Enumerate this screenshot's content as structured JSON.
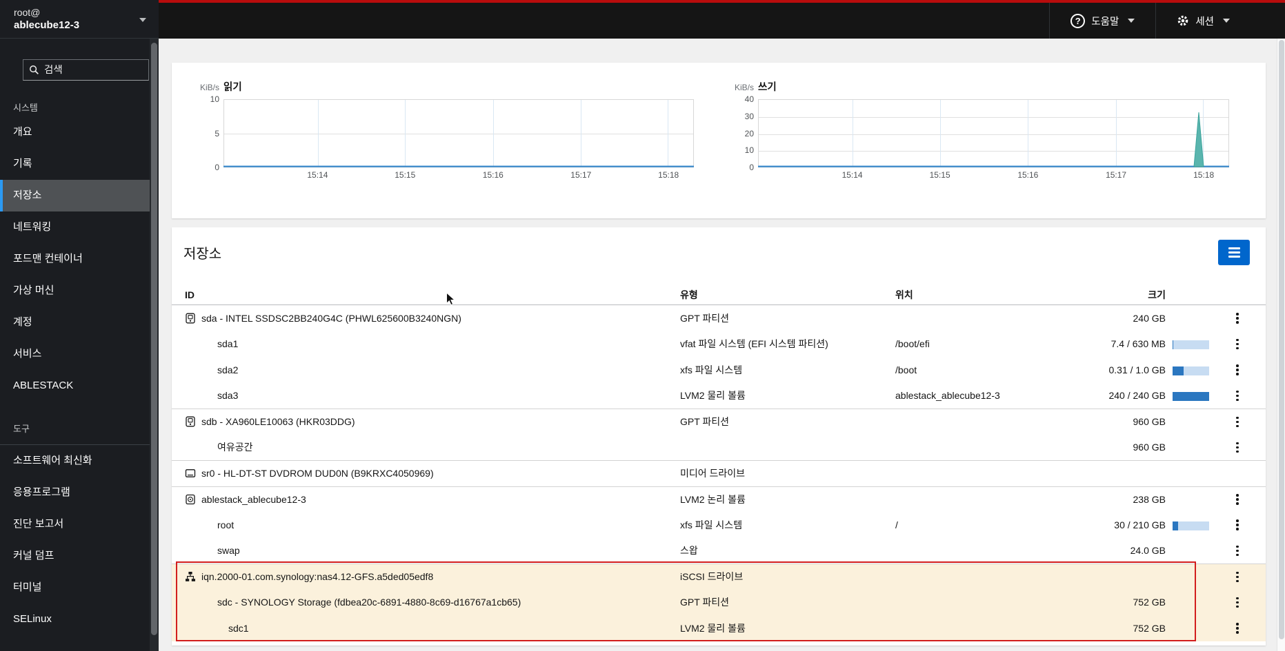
{
  "masthead": {
    "host_user": "root@",
    "host_name": "ablecube12-3",
    "help_label": "도움말",
    "session_label": "세션"
  },
  "sidebar": {
    "search_placeholder": "검색",
    "sections": [
      {
        "title": "시스템",
        "selected": "저장소",
        "items": [
          "개요",
          "기록",
          "저장소",
          "네트워킹",
          "포드맨 컨테이너",
          "가상 머신",
          "계정",
          "서비스",
          "ABLESTACK"
        ]
      },
      {
        "title": "도구",
        "items": [
          "소프트웨어 최신화",
          "응용프로그램",
          "진단 보고서",
          "커널 덤프",
          "터미널",
          "SELinux"
        ]
      }
    ]
  },
  "chart_data": [
    {
      "type": "area",
      "title": "읽기",
      "unit": "KiB/s",
      "x": [
        "15:14",
        "15:15",
        "15:16",
        "15:17",
        "15:18"
      ],
      "series": [
        {
          "name": "읽기",
          "values": [
            0,
            0,
            0,
            0,
            0
          ]
        }
      ],
      "ylim": [
        0,
        10
      ],
      "yticks": [
        10,
        5,
        0
      ],
      "grid": true,
      "line_color": "#3e8ed0"
    },
    {
      "type": "area",
      "title": "쓰기",
      "unit": "KiB/s",
      "x": [
        "15:14",
        "15:15",
        "15:16",
        "15:17",
        "15:18"
      ],
      "series": [
        {
          "name": "쓰기",
          "values": [
            0,
            0,
            0,
            0,
            32
          ]
        }
      ],
      "ylim": [
        0,
        40
      ],
      "yticks": [
        40,
        30,
        20,
        10,
        0
      ],
      "grid": true,
      "line_color": "#3e8ed0",
      "spike_color": "#5ab5ae",
      "spike_note": "spike ≈32 KiB/s at 15:18"
    }
  ],
  "storage": {
    "title": "저장소",
    "columns": {
      "id": "ID",
      "type": "유형",
      "location": "위치",
      "size": "크기"
    },
    "rows": [
      {
        "id": "sda - INTEL SSDSC2BB240G4C (PHWL625600B3240NGN)",
        "type": "GPT 파티션",
        "size": "240 GB"
      },
      {
        "id": "sda1",
        "type": "vfat 파일 시스템 (EFI 시스템 파티션)",
        "location": "/boot/efi",
        "size": "7.4 / 630 MB",
        "usage_pct": "1.2%"
      },
      {
        "id": "sda2",
        "type": "xfs 파일 시스템",
        "location": "/boot",
        "size": "0.31 / 1.0 GB",
        "usage_pct": "31%"
      },
      {
        "id": "sda3",
        "type": "LVM2 물리 볼륨",
        "location": "ablestack_ablecube12-3",
        "size": "240 / 240 GB",
        "usage_pct": "100%"
      },
      {
        "id": "sdb - XA960LE10063 (HKR03DDG)",
        "type": "GPT 파티션",
        "size": "960 GB"
      },
      {
        "id": "여유공간",
        "size": "960 GB"
      },
      {
        "id": "sr0 - HL-DT-ST DVDROM DUD0N (B9KRXC4050969)",
        "type": "미디어 드라이브"
      },
      {
        "id": "ablestack_ablecube12-3",
        "type": "LVM2 논리 볼륨",
        "size": "238 GB"
      },
      {
        "id": "root",
        "type": "xfs 파일 시스템",
        "location": "/",
        "size": "30 / 210 GB",
        "usage_pct": "14.3%"
      },
      {
        "id": "swap",
        "type": "스왑",
        "size": "24.0 GB"
      },
      {
        "id": "iqn.2000-01.com.synology:nas4.12-GFS.a5ded05edf8",
        "type": "iSCSI 드라이브"
      },
      {
        "id": "sdc - SYNOLOGY Storage (fdbea20c-6891-4880-8c69-d16767a1cb65)",
        "type": "GPT 파티션",
        "size": "752 GB"
      },
      {
        "id": "sdc1",
        "type": "LVM2 물리 볼륨",
        "size": "752 GB"
      }
    ]
  }
}
